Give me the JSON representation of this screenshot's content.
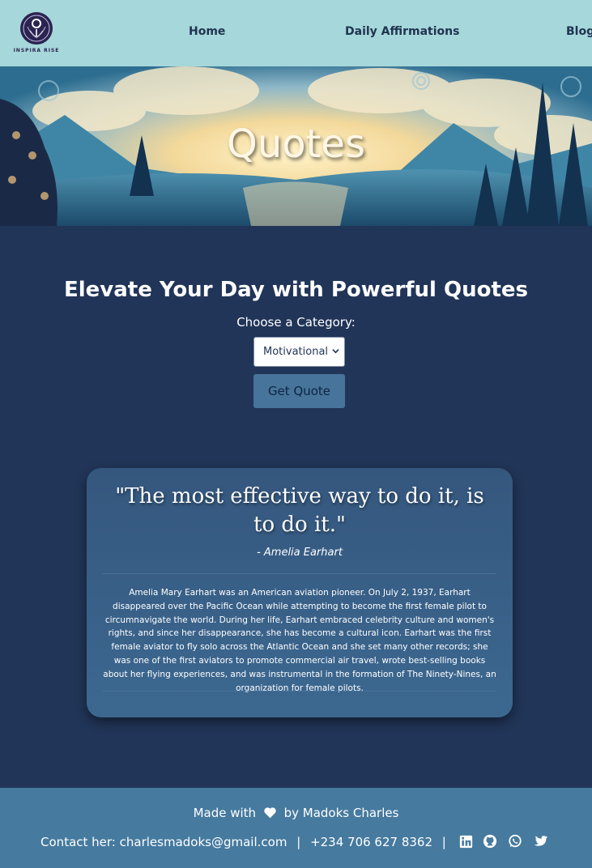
{
  "brand": {
    "name": "INSPIRA RISE"
  },
  "nav": {
    "items": [
      {
        "label": "Home"
      },
      {
        "label": "Daily Affirmations"
      },
      {
        "label": "Blog"
      }
    ]
  },
  "hero": {
    "title": "Quotes"
  },
  "main": {
    "heading": "Elevate Your Day with Powerful Quotes",
    "category_label": "Choose a Category:",
    "category_selected": "Motivational",
    "button_label": "Get Quote"
  },
  "quote_card": {
    "text": "\"The most effective way to do it, is to do it.\"",
    "author": "- Amelia Earhart",
    "bio": "Amelia Mary Earhart was an American aviation pioneer. On July 2, 1937, Earhart disappeared over the Pacific Ocean while attempting to become the first female pilot to circumnavigate the world. During her life, Earhart embraced celebrity culture and women's rights, and since her disappearance, she has become a cultural icon. Earhart was the first female aviator to fly solo across the Atlantic Ocean and she set many other records; she was one of the first aviators to promote commercial air travel, wrote best-selling books about her flying experiences, and was instrumental in the formation of The Ninety-Nines, an organization for female pilots."
  },
  "footer": {
    "made_prefix": "Made with",
    "made_suffix": "by Madoks Charles",
    "contact_label": "Contact her:",
    "email": "charlesmadoks@gmail.com",
    "phone": "+234 706 627 8362",
    "separator": "|",
    "social_icons": [
      "linkedin-icon",
      "github-icon",
      "whatsapp-icon",
      "twitter-icon"
    ]
  },
  "colors": {
    "nav_bg": "#a6d7da",
    "page_bg": "#213558",
    "card_bg": "#3a6189",
    "button_bg": "#47749a",
    "footer_bg": "#467a9f"
  }
}
